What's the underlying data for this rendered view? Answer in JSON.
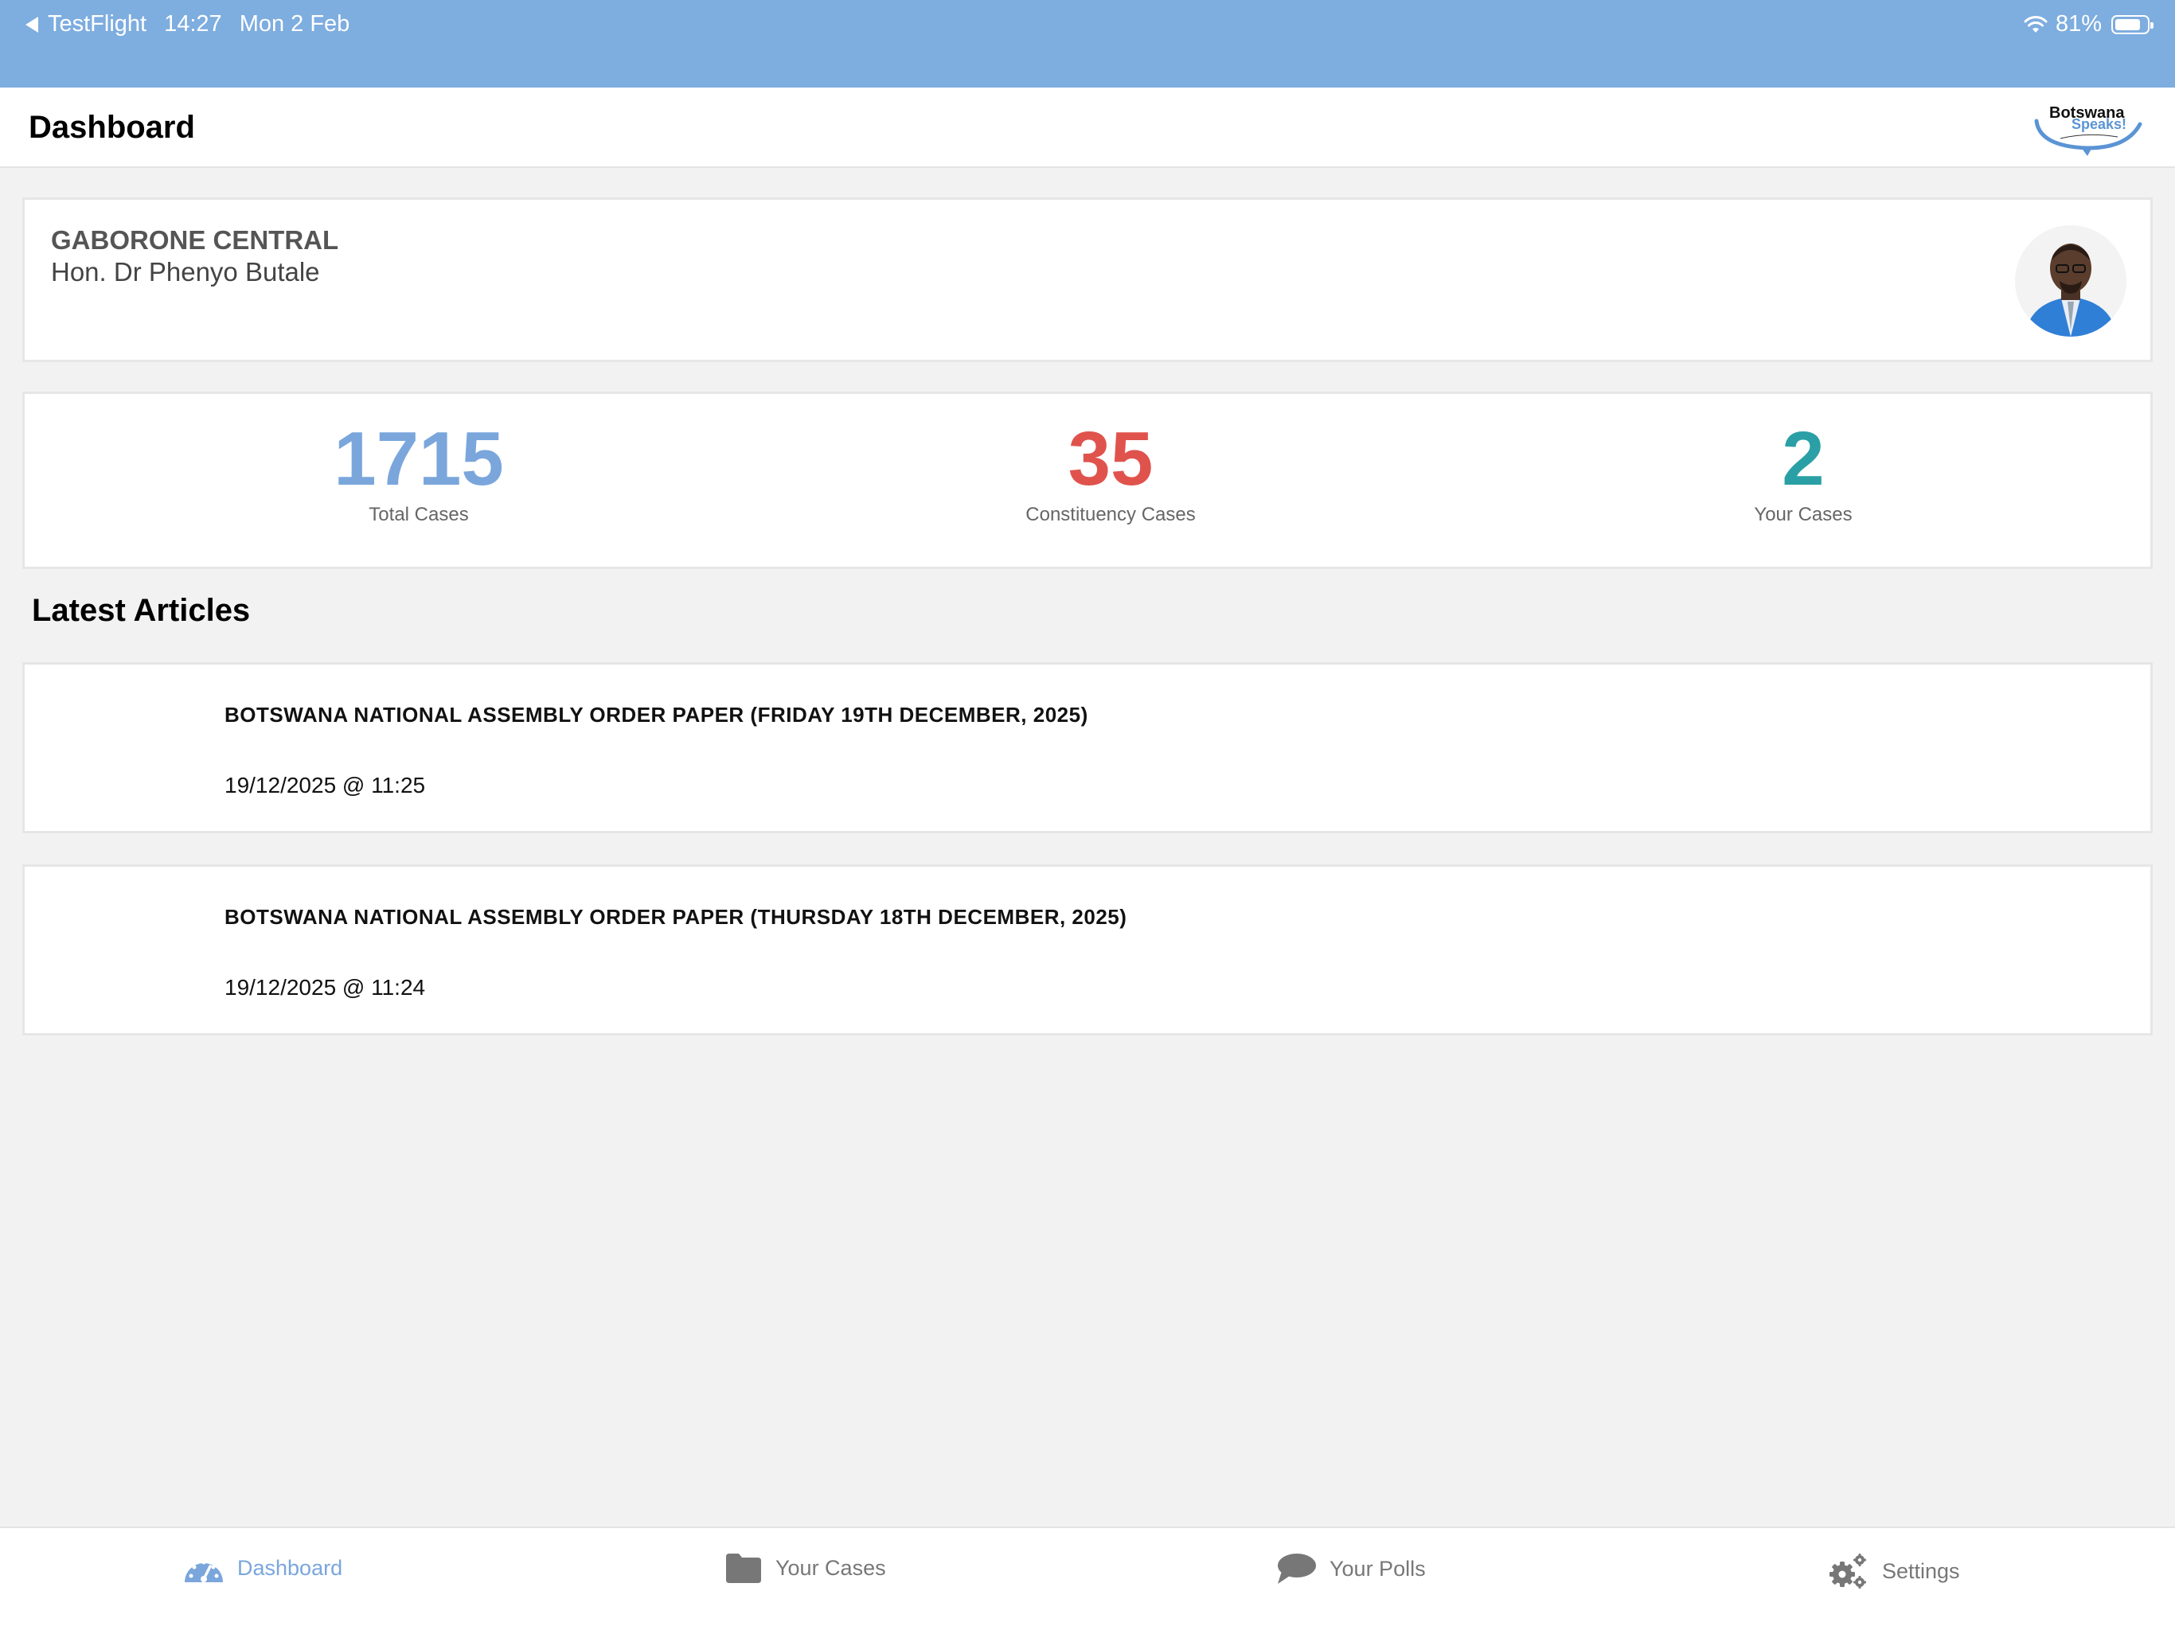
{
  "status_bar": {
    "back_app": "TestFlight",
    "time": "14:27",
    "date": "Mon 2 Feb",
    "battery": "81%",
    "battery_level": 0.81
  },
  "header": {
    "title": "Dashboard",
    "logo_icon": "botswana-speaks-logo"
  },
  "profile": {
    "constituency": "GABORONE CENTRAL",
    "mp_name": "Hon. Dr Phenyo  Butale",
    "avatar_icon": "mp-avatar"
  },
  "stats": {
    "total": {
      "value": "1715",
      "label": "Total Cases",
      "color": "#7aa6dc"
    },
    "constituency": {
      "value": "35",
      "label": "Constituency Cases",
      "color": "#e0534d"
    },
    "yours": {
      "value": "2",
      "label": "Your Cases",
      "color": "#2aa0a6"
    }
  },
  "articles_section": {
    "title": "Latest Articles"
  },
  "articles": [
    {
      "title": "BOTSWANA NATIONAL ASSEMBLY  ORDER PAPER (FRIDAY 19TH DECEMBER, 2025)",
      "date": "19/12/2025 @ 11:25"
    },
    {
      "title": "BOTSWANA NATIONAL ASSEMBLY  ORDER PAPER (THURSDAY 18TH DECEMBER, 2025)",
      "date": "19/12/2025 @ 11:24"
    }
  ],
  "tabs": [
    {
      "label": "Dashboard",
      "icon": "dashboard-gauge-icon",
      "active": true
    },
    {
      "label": "Your Cases",
      "icon": "folder-icon",
      "active": false
    },
    {
      "label": "Your Polls",
      "icon": "chat-bubble-icon",
      "active": false
    },
    {
      "label": "Settings",
      "icon": "gears-icon",
      "active": false
    }
  ],
  "colors": {
    "status_bar": "#7eaddf",
    "accent": "#7aa6dc",
    "background": "#f2f2f2"
  }
}
